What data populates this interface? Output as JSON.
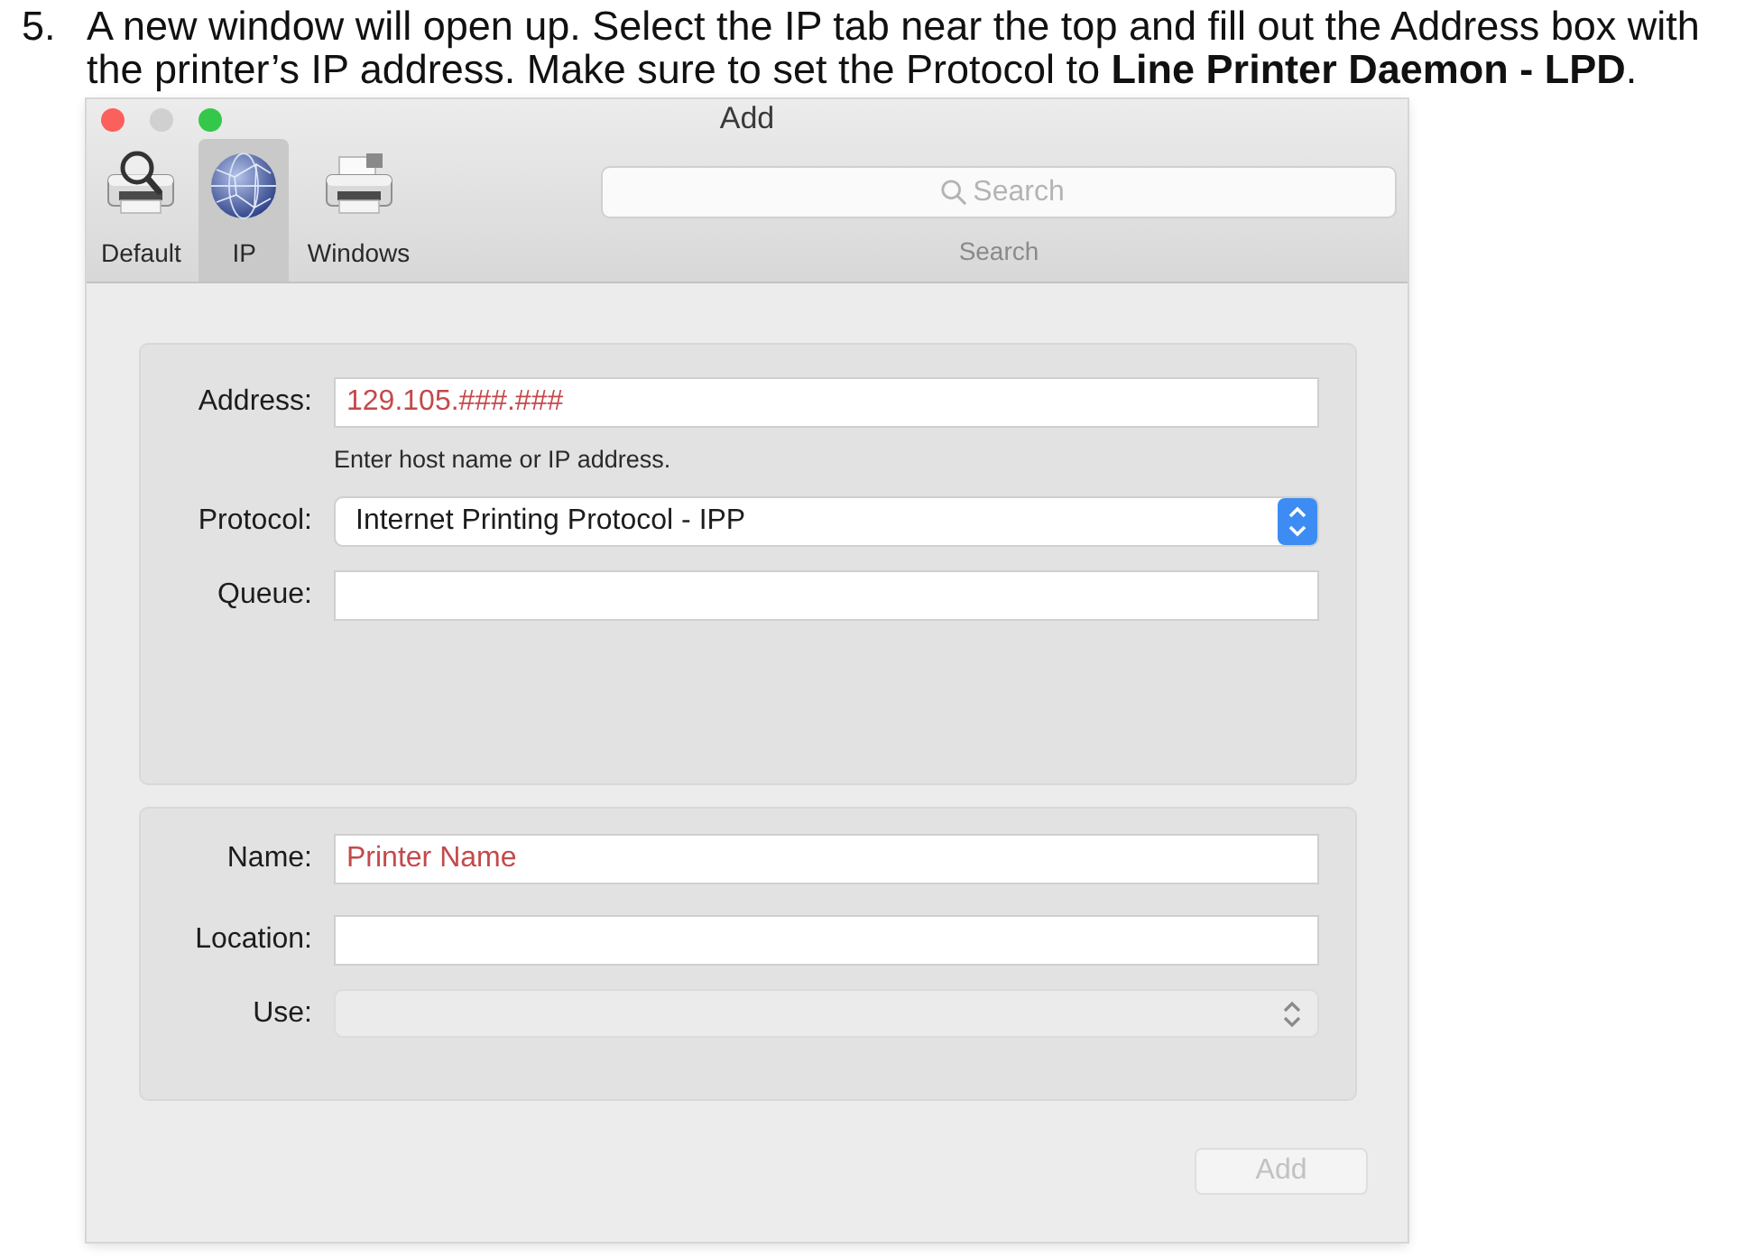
{
  "instruction": {
    "number": "5.",
    "text": "A new window will open up. Select the IP tab near the top and fill out the Address box with the printer’s IP address. Make sure to set the Protocol to **Line Printer Daemon - LPD**."
  },
  "window": {
    "title": "Add"
  },
  "toolbar": {
    "tabs": [
      {
        "kind": "default",
        "label": "Default",
        "selected": false
      },
      {
        "kind": "ip",
        "label": "IP",
        "selected": true
      },
      {
        "kind": "windows",
        "label": "Windows",
        "selected": false
      }
    ],
    "search": {
      "placeholder": "Search",
      "label": "Search"
    }
  },
  "connection_group": {
    "fields": [
      {
        "kind": "text",
        "label": "Address:",
        "value": "129.105.###.###",
        "color": "#c4494b",
        "hint": "Enter host name or IP address."
      },
      {
        "kind": "popup",
        "label": "Protocol:",
        "value": "Internet Printing Protocol - IPP",
        "disabled": false
      },
      {
        "kind": "text",
        "label": "Queue:"
      }
    ]
  },
  "info_group": {
    "fields": [
      {
        "kind": "text",
        "label": "Name:",
        "value": "Printer Name",
        "color": "#c4494b"
      },
      {
        "kind": "text",
        "label": "Location:"
      },
      {
        "kind": "popup",
        "label": "Use:",
        "disabled": true
      }
    ]
  },
  "add_button": {
    "label": "Add",
    "disabled": true
  }
}
